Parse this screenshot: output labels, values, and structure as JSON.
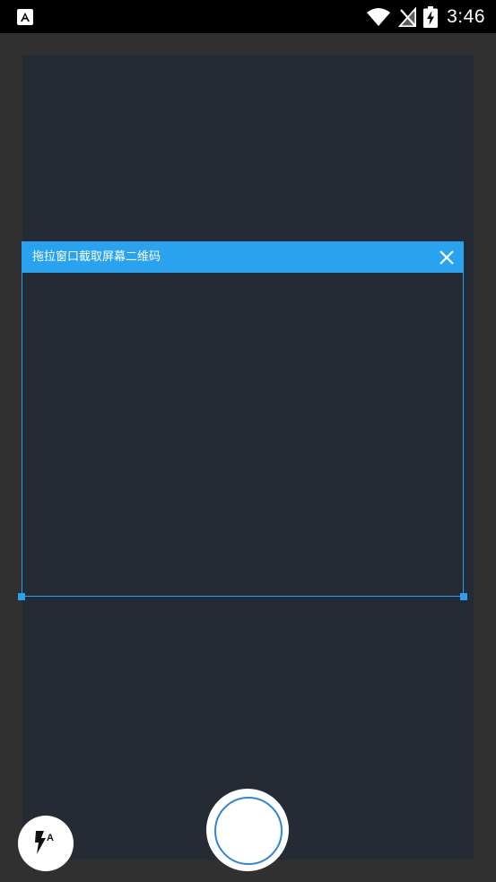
{
  "status_bar": {
    "time": "3:46",
    "icons": [
      "app-notification-icon",
      "wifi-icon",
      "no-signal-icon",
      "battery-charging-icon"
    ]
  },
  "capture_window": {
    "title": "拖拉窗口截取屏幕二维码",
    "close_icon": "close-icon"
  },
  "controls": {
    "flash_icon": "flash-auto-icon",
    "flash_mode_letter": "A",
    "shutter": "shutter-button"
  },
  "colors": {
    "accent": "#29a3ef",
    "preview_bg": "#252b34",
    "frame_bg": "#303030",
    "status_bg": "#000000"
  }
}
